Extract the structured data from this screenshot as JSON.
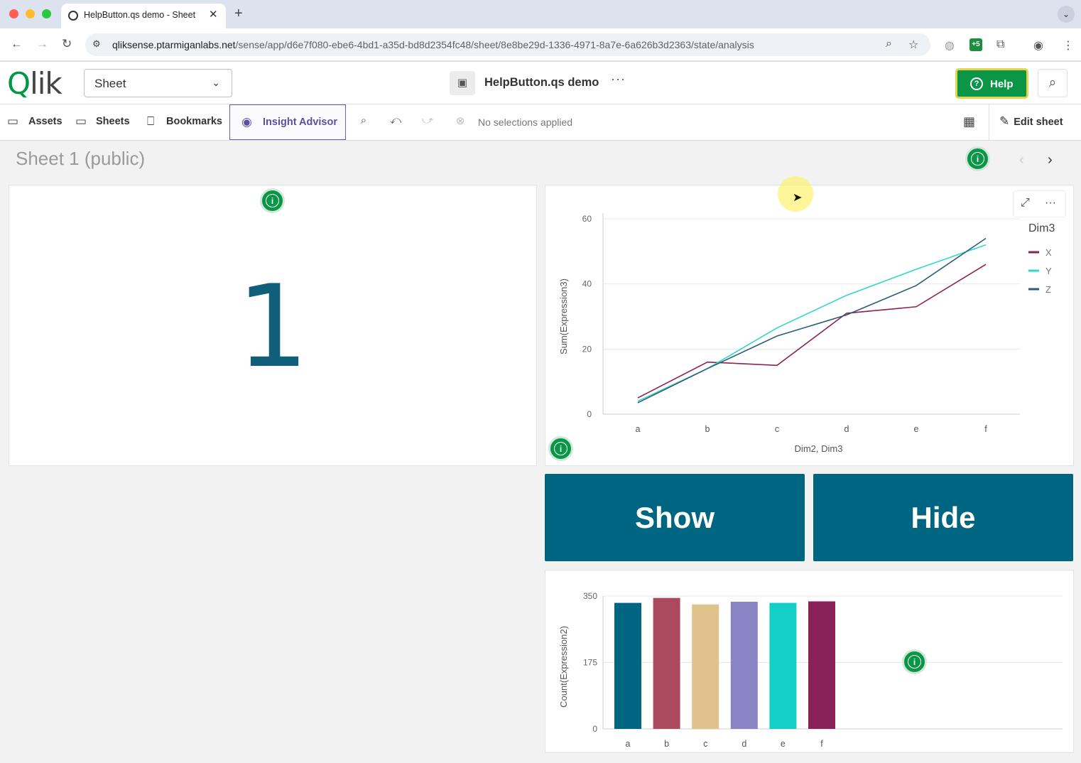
{
  "browser": {
    "tab_title": "HelpButton.qs demo - Sheet",
    "tab_close": "✕",
    "new_tab": "+",
    "url_host": "qliksense.ptarmiganlabs.net",
    "url_path": "/sense/app/d6e7f080-ebe6-4bd1-a35d-bd8d2354fc48/sheet/8e8be29d-1336-4971-8a7e-6a626b3d2363/state/analysis",
    "ext_green": "+5"
  },
  "header": {
    "logo_q": "Q",
    "logo_rest": "lik",
    "sheet_select": "Sheet",
    "app_title": "HelpButton.qs demo",
    "more": "···",
    "help_label": "Help"
  },
  "toolbar": {
    "assets": "Assets",
    "sheets": "Sheets",
    "bookmarks": "Bookmarks",
    "insight_advisor": "Insight Advisor",
    "no_selections": "No selections applied",
    "edit_sheet": "Edit sheet"
  },
  "sheet": {
    "title": "Sheet 1 (public)",
    "info_glyph": "i"
  },
  "kpi": {
    "value": "1"
  },
  "buttons": {
    "show": "Show",
    "hide": "Hide"
  },
  "colors": {
    "x": "#8b2252",
    "y": "#2fd9c5",
    "z": "#2b5c78",
    "bar_a": "#006580",
    "bar_b": "#ab4a5e",
    "bar_c": "#e0c28c",
    "bar_d": "#8a84c4",
    "bar_e": "#14cfc6",
    "bar_f": "#8a2158",
    "accent": "#0a9646"
  },
  "chart_data": [
    {
      "type": "line",
      "categories": [
        "a",
        "b",
        "c",
        "d",
        "e",
        "f"
      ],
      "series": [
        {
          "name": "X",
          "values": [
            5,
            16,
            15,
            31,
            33,
            46
          ]
        },
        {
          "name": "Y",
          "values": [
            4,
            14,
            26.5,
            36.5,
            44.5,
            52
          ]
        },
        {
          "name": "Z",
          "values": [
            3.5,
            14,
            24,
            30.5,
            39.5,
            54
          ]
        }
      ],
      "xlabel": "Dim2, Dim3",
      "ylabel": "Sum(Expression3)",
      "legend_title": "Dim3",
      "ylim": [
        0,
        60
      ],
      "yticks": [
        0,
        20,
        40,
        60
      ],
      "grid": true,
      "legend": "top-right"
    },
    {
      "type": "bar",
      "categories": [
        "a",
        "b",
        "c",
        "d",
        "e",
        "f"
      ],
      "values": [
        332,
        345,
        328,
        335,
        332,
        336
      ],
      "xlabel": "",
      "ylabel": "Count(Expression2)",
      "ylim": [
        0,
        350
      ],
      "yticks": [
        0,
        175,
        350
      ],
      "grid": true
    }
  ]
}
